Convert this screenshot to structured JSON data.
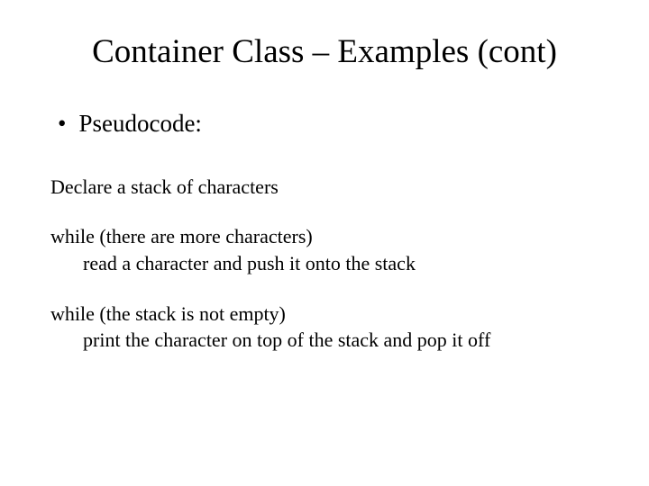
{
  "title": "Container Class – Examples (cont)",
  "bullet": {
    "dot": "•",
    "label": "Pseudocode:"
  },
  "code": {
    "declare": "Declare a stack of characters",
    "while1_head": "while (there are more characters)",
    "while1_body": "read a character and push it onto the stack",
    "while2_head": "while (the stack is not empty)",
    "while2_body": "print the character on top of the stack and pop it off"
  }
}
